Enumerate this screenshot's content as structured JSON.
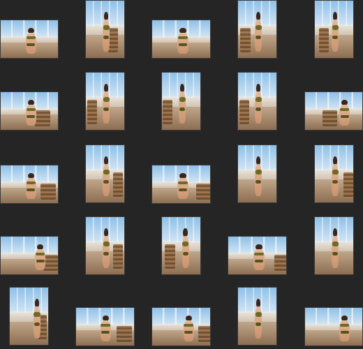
{
  "gallery": {
    "background_color": "#252525",
    "thumbnail_count": 25,
    "rows": 5,
    "columns": 5
  }
}
